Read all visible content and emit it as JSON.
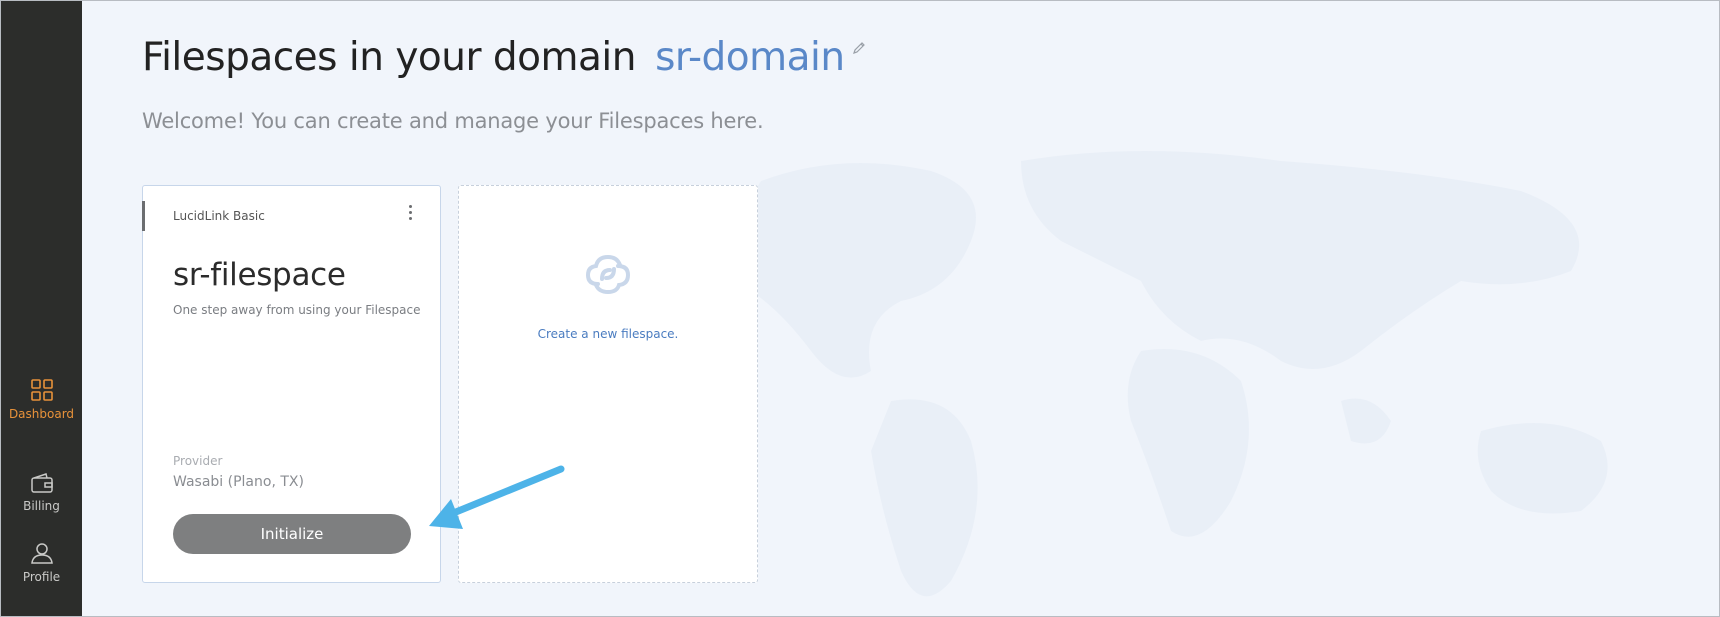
{
  "sidebar": {
    "items": [
      {
        "label": "Dashboard",
        "icon": "grid-icon",
        "active": true
      },
      {
        "label": "Billing",
        "icon": "wallet-icon",
        "active": false
      },
      {
        "label": "Profile",
        "icon": "user-icon",
        "active": false
      }
    ]
  },
  "header": {
    "title": "Filespaces in your domain",
    "domain": "sr-domain",
    "welcome": "Welcome! You can create and manage your Filespaces here."
  },
  "filespace_card": {
    "plan": "LucidLink Basic",
    "name": "sr-filespace",
    "subtitle": "One step away from using your Filespace",
    "provider_label": "Provider",
    "provider_value": "Wasabi (Plano, TX)",
    "button_label": "Initialize"
  },
  "new_card": {
    "link_text": "Create a new filespace."
  },
  "colors": {
    "sidebar_bg": "#2c2d2b",
    "active_accent": "#e8923a",
    "domain_blue": "#5a88c8",
    "annotation_arrow": "#4db3e8",
    "button_bg": "#7e7f80"
  }
}
